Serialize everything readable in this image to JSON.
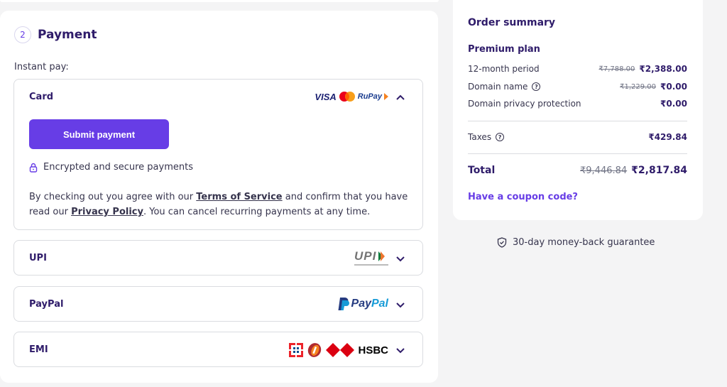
{
  "payment": {
    "step": "2",
    "title": "Payment",
    "instant_label": "Instant pay:",
    "card": {
      "label": "Card",
      "logos": [
        "VISA",
        "mastercard",
        "RuPay"
      ],
      "submit_label": "Submit payment",
      "secure_text": "Encrypted and secure payments",
      "agree_1": "By checking out you agree with our ",
      "terms_link": "Terms of Service",
      "agree_2": " and confirm that you have read our ",
      "privacy_link": "Privacy Policy",
      "agree_3": ". You can cancel recurring payments at any time."
    },
    "upi": {
      "label": "UPI",
      "logo_text": "UPI"
    },
    "paypal": {
      "label": "PayPal",
      "logo_pay": "Pay",
      "logo_pal": "Pal"
    },
    "emi": {
      "label": "EMI",
      "logo_text": "HSBC"
    }
  },
  "summary": {
    "title": "Order summary",
    "plan": "Premium plan",
    "rows": [
      {
        "label": "12-month period",
        "old": "₹7,788.00",
        "value": "₹2,388.00"
      },
      {
        "label": "Domain name",
        "old": "₹1,229.00",
        "value": "₹0.00"
      },
      {
        "label": "Domain privacy protection",
        "old": "",
        "value": "₹0.00"
      }
    ],
    "taxes": {
      "label": "Taxes",
      "value": "₹429.84"
    },
    "total": {
      "label": "Total",
      "old": "₹9,446.84",
      "value": "₹2,817.84"
    },
    "coupon": "Have a coupon code?"
  },
  "guarantee": "30-day money-back guarantee",
  "colors": {
    "accent": "#673de6",
    "heading": "#2f1c6a",
    "text": "#36344d"
  }
}
